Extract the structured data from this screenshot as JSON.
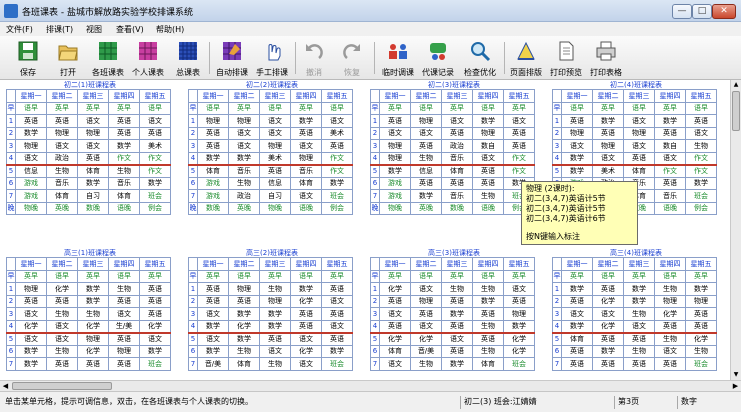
{
  "window": {
    "title": "各班课表 - 盐城市解放路实验学校排课系统",
    "min": "—",
    "max": "□",
    "close": "✕"
  },
  "menu": [
    "文件(F)",
    "排课(T)",
    "视图",
    "查看(V)",
    "帮助(H)"
  ],
  "toolbar": [
    {
      "label": "保存",
      "icon": "save-icon"
    },
    {
      "label": "打开",
      "icon": "open-icon"
    },
    {
      "label": "各班课表",
      "icon": "class-table-icon"
    },
    {
      "label": "个人课表",
      "icon": "personal-table-icon"
    },
    {
      "label": "总课表",
      "icon": "master-table-icon"
    },
    {
      "label": "自动排课",
      "icon": "auto-schedule-icon"
    },
    {
      "label": "手工排课",
      "icon": "hand-icon"
    },
    {
      "label": "撤消",
      "icon": "undo-icon"
    },
    {
      "label": "恢复",
      "icon": "redo-icon"
    },
    {
      "label": "临时调课",
      "icon": "temp-swap-icon"
    },
    {
      "label": "代课记录",
      "icon": "substitute-icon"
    },
    {
      "label": "检查优化",
      "icon": "check-icon"
    },
    {
      "label": "页面排版",
      "icon": "layout-icon"
    },
    {
      "label": "打印预览",
      "icon": "preview-icon"
    },
    {
      "label": "打印表格",
      "icon": "print-icon"
    }
  ],
  "days": [
    "星期一",
    "星期二",
    "星期三",
    "星期四",
    "星期五"
  ],
  "sheets": [
    {
      "title": "初二(1)班课程表",
      "rows": [
        [
          "早",
          "语早",
          "英早",
          "英早",
          "英早",
          "语早"
        ],
        [
          "1",
          "英语",
          "英语",
          "语文",
          "英语",
          "语文"
        ],
        [
          "2",
          "数学",
          "物理",
          "物理",
          "英语",
          "英语"
        ],
        [
          "3",
          "物理",
          "语文",
          "语文",
          "数学",
          "美术"
        ],
        [
          "4",
          "语文",
          "政治",
          "英语",
          "作文",
          "作文"
        ],
        [
          "5",
          "信息",
          "生物",
          "体育",
          "生物",
          "作文"
        ],
        [
          "6",
          "游戏",
          "音乐",
          "数学",
          "音乐",
          "数学"
        ],
        [
          "7",
          "游戏",
          "体育",
          "自习",
          "体育",
          "班会"
        ],
        [
          "晚",
          "物晚",
          "英晚",
          "数晚",
          "语晚",
          "例会"
        ]
      ]
    },
    {
      "title": "初二(2)班课程表",
      "rows": [
        [
          "早",
          "语早",
          "英早",
          "语早",
          "英早",
          "语早"
        ],
        [
          "1",
          "物理",
          "物理",
          "语文",
          "数学",
          "语文"
        ],
        [
          "2",
          "英语",
          "语文",
          "语文",
          "英语",
          "美术"
        ],
        [
          "3",
          "英语",
          "语文",
          "物理",
          "语文",
          "英语"
        ],
        [
          "4",
          "数学",
          "数学",
          "美术",
          "物理",
          "作文"
        ],
        [
          "5",
          "体育",
          "音乐",
          "英语",
          "音乐",
          "作文"
        ],
        [
          "6",
          "游戏",
          "生物",
          "信息",
          "体育",
          "数学"
        ],
        [
          "7",
          "游戏",
          "政治",
          "自习",
          "语文",
          "班会"
        ],
        [
          "晚",
          "数晚",
          "英晚",
          "物晚",
          "语晚",
          "例会"
        ]
      ]
    },
    {
      "title": "初二(3)班课程表",
      "rows": [
        [
          "早",
          "英早",
          "语早",
          "英早",
          "语早",
          "英早"
        ],
        [
          "1",
          "英语",
          "物理",
          "语文",
          "数学",
          "语文"
        ],
        [
          "2",
          "语文",
          "语文",
          "英语",
          "物理",
          "英语"
        ],
        [
          "3",
          "物理",
          "英语",
          "政治",
          "数自",
          "英语"
        ],
        [
          "4",
          "物理",
          "生物",
          "音乐",
          "语文",
          "作文"
        ],
        [
          "5",
          "数学",
          "信息",
          "体育",
          "英语",
          "作文"
        ],
        [
          "6",
          "游戏",
          "英语",
          "英语",
          "英语",
          "数学"
        ],
        [
          "7",
          "游戏",
          "数学",
          "音乐",
          "生物",
          "班会"
        ],
        [
          "晚",
          "物晚",
          "英晚",
          "数晚",
          "语晚",
          "例会"
        ]
      ]
    },
    {
      "title": "初二(4)班课程表",
      "rows": [
        [
          "早",
          "语早",
          "英早",
          "语早",
          "英早",
          "语早"
        ],
        [
          "1",
          "英语",
          "数学",
          "语文",
          "数学",
          "英语"
        ],
        [
          "2",
          "物理",
          "英语",
          "物理",
          "英语",
          "语文"
        ],
        [
          "3",
          "语文",
          "物理",
          "语文",
          "数自",
          "生物"
        ],
        [
          "4",
          "数学",
          "语文",
          "英语",
          "语文",
          "作文"
        ],
        [
          "5",
          "数学",
          "美术",
          "体育",
          "作文",
          "作文"
        ],
        [
          "6",
          "游戏",
          "政治",
          "音乐",
          "英语",
          "数学"
        ],
        [
          "7",
          "游戏",
          "信息",
          "体育",
          "音乐",
          "班会"
        ],
        [
          "晚",
          "物晚",
          "英晚",
          "数晚",
          "语晚",
          "例会"
        ]
      ]
    },
    {
      "title": "高三(1)班课程表",
      "rows": [
        [
          "早",
          "英早",
          "语早",
          "英早",
          "语早",
          "英早"
        ],
        [
          "1",
          "物理",
          "化学",
          "数学",
          "生物",
          "英语"
        ],
        [
          "2",
          "英语",
          "英语",
          "数学",
          "英语",
          "英语"
        ],
        [
          "3",
          "语文",
          "生物",
          "生物",
          "语文",
          "英语"
        ],
        [
          "4",
          "化学",
          "语文",
          "化学",
          "生/美",
          "化学"
        ],
        [
          "5",
          "语文",
          "语文",
          "物理",
          "英语",
          "语文"
        ],
        [
          "6",
          "数学",
          "生物",
          "化学",
          "物理",
          "数学"
        ],
        [
          "7",
          "数学",
          "英语",
          "英语",
          "英语",
          "班会"
        ]
      ]
    },
    {
      "title": "高三(2)班课程表",
      "rows": [
        [
          "早",
          "英早",
          "语早",
          "英早",
          "语早",
          "英早"
        ],
        [
          "1",
          "英语",
          "物理",
          "生物",
          "数学",
          "英语"
        ],
        [
          "2",
          "英语",
          "英语",
          "物理",
          "化学",
          "语文"
        ],
        [
          "3",
          "语文",
          "数学",
          "数学",
          "英语",
          "英语"
        ],
        [
          "4",
          "数学",
          "化学",
          "数学",
          "英语",
          "语文"
        ],
        [
          "5",
          "语文",
          "数学",
          "英语",
          "语文",
          "英语"
        ],
        [
          "6",
          "数学",
          "生物",
          "语文",
          "化学",
          "数学"
        ],
        [
          "7",
          "音/美",
          "体育",
          "生物",
          "语文",
          "班会"
        ]
      ]
    },
    {
      "title": "高三(3)班课程表",
      "rows": [
        [
          "早",
          "英早",
          "语早",
          "英早",
          "语早",
          "英早"
        ],
        [
          "1",
          "化学",
          "语文",
          "生物",
          "生物",
          "语文"
        ],
        [
          "2",
          "英语",
          "物理",
          "英语",
          "数学",
          "英语"
        ],
        [
          "3",
          "语文",
          "英语",
          "数学",
          "英语",
          "物理"
        ],
        [
          "4",
          "英语",
          "语文",
          "英语",
          "生物",
          "数学"
        ],
        [
          "5",
          "化学",
          "化学",
          "语文",
          "英语",
          "化学"
        ],
        [
          "6",
          "体育",
          "音/美",
          "英语",
          "生物",
          "化学"
        ],
        [
          "7",
          "语文",
          "生物",
          "数学",
          "体育",
          "班会"
        ]
      ]
    },
    {
      "title": "高三(4)班课程表",
      "rows": [
        [
          "早",
          "英早",
          "语早",
          "英早",
          "语早",
          "英早"
        ],
        [
          "1",
          "数学",
          "英语",
          "数学",
          "生物",
          "数学"
        ],
        [
          "2",
          "英语",
          "化学",
          "数学",
          "物理",
          "物理"
        ],
        [
          "3",
          "语文",
          "语文",
          "生物",
          "化学",
          "英语"
        ],
        [
          "4",
          "数学",
          "化学",
          "语文",
          "英语",
          "英语"
        ],
        [
          "5",
          "体育",
          "英语",
          "英语",
          "生物",
          "化学"
        ],
        [
          "6",
          "英语",
          "数学",
          "生物",
          "语文",
          "生物"
        ],
        [
          "7",
          "英语",
          "英语",
          "英语",
          "英语",
          "班会"
        ]
      ]
    }
  ],
  "popup": {
    "lines": [
      "物理 (2课时):",
      "初二(3,4,7)英语计5节",
      "初二(3,4,7)英语计5节",
      "初二(3,4,7)英语计6节"
    ],
    "hint": "按N键输入标注"
  },
  "status": {
    "hint": "单击某单元格，提示可调信息，双击，在各班课表与个人课表的切换。",
    "class": "初二(3) 班会:江婧婧",
    "page": "第3页",
    "mode": "数字"
  },
  "colors": {
    "accent": "#1a3fd1",
    "green": "#1a8b2c",
    "popup": "#ffffb6",
    "divider": "#c0392b"
  }
}
